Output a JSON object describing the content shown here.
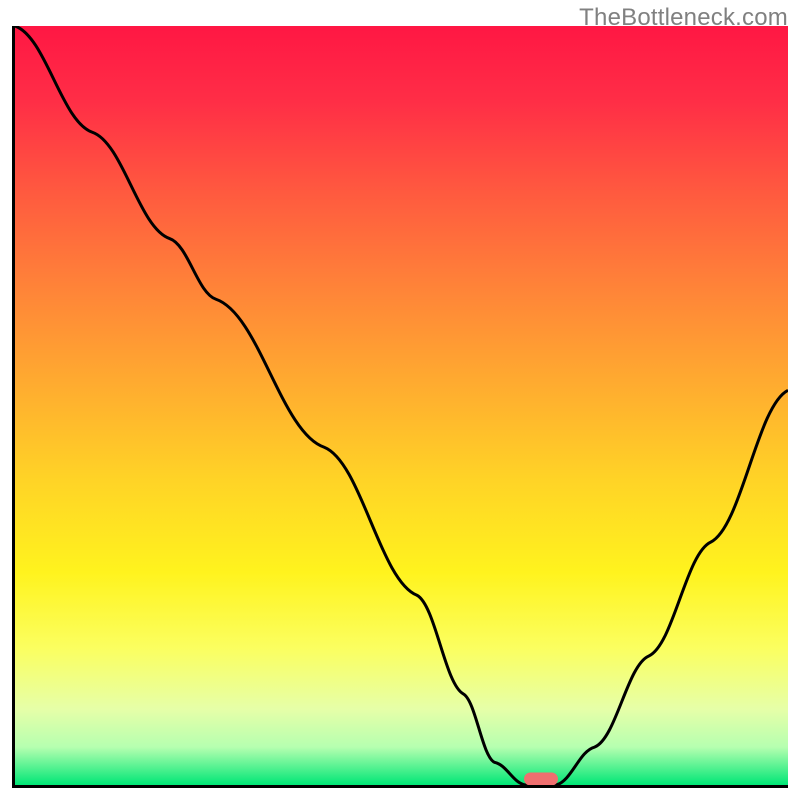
{
  "watermark": "TheBottleneck.com",
  "chart_data": {
    "type": "line",
    "title": "",
    "xlabel": "",
    "ylabel": "",
    "xlim": [
      0,
      100
    ],
    "ylim": [
      0,
      100
    ],
    "grid": false,
    "legend": false,
    "gradient_stops": [
      {
        "pct": 0,
        "color": "#ff1744"
      },
      {
        "pct": 10,
        "color": "#ff2e46"
      },
      {
        "pct": 22,
        "color": "#ff5a3f"
      },
      {
        "pct": 35,
        "color": "#ff8538"
      },
      {
        "pct": 48,
        "color": "#ffae2f"
      },
      {
        "pct": 60,
        "color": "#ffd426"
      },
      {
        "pct": 72,
        "color": "#fff31e"
      },
      {
        "pct": 82,
        "color": "#fbff60"
      },
      {
        "pct": 90,
        "color": "#e6ffa8"
      },
      {
        "pct": 95,
        "color": "#b6ffb0"
      },
      {
        "pct": 100,
        "color": "#00e676"
      }
    ],
    "series": [
      {
        "name": "bottleneck-curve",
        "x": [
          0,
          10,
          20,
          26,
          40,
          52,
          58,
          62,
          66,
          70,
          75,
          82,
          90,
          100
        ],
        "y": [
          100,
          86,
          72,
          64,
          44.5,
          25,
          12,
          3,
          0,
          0,
          5,
          17,
          32,
          52
        ]
      }
    ],
    "marker": {
      "name": "optimal-point",
      "x": 68,
      "y": 0,
      "color": "#ef6f6f"
    }
  }
}
